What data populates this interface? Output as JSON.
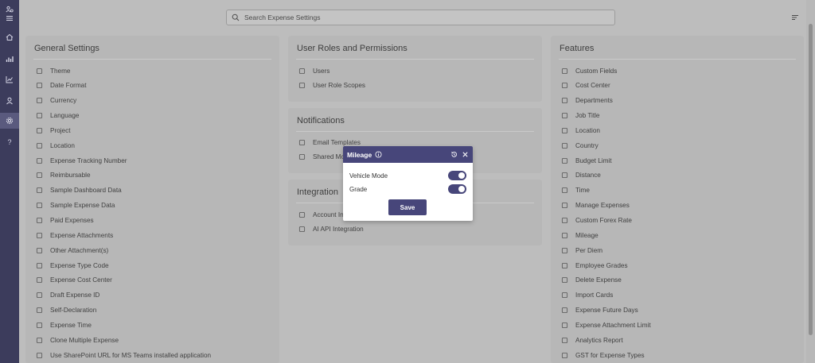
{
  "search": {
    "placeholder": "Search Expense Settings"
  },
  "rail": {
    "icons": [
      "users-cog-icon",
      "menu-icon",
      "home-icon",
      "bar-chart-icon",
      "line-chart-icon",
      "user-icon",
      "gear-icon",
      "help-icon"
    ]
  },
  "general": {
    "title": "General Settings",
    "items": [
      "Theme",
      "Date Format",
      "Currency",
      "Language",
      "Project",
      "Location",
      "Expense Tracking Number",
      "Reimbursable",
      "Sample Dashboard Data",
      "Sample Expense Data",
      "Paid Expenses",
      "Expense Attachments",
      "Other Attachment(s)",
      "Expense Type Code",
      "Expense Cost Center",
      "Draft Expense ID",
      "Self-Declaration",
      "Expense Time",
      "Clone Multiple Expense",
      "Use SharePoint URL for MS Teams installed application"
    ]
  },
  "roles": {
    "title": "User Roles and Permissions",
    "items": [
      "Users",
      "User Role Scopes"
    ]
  },
  "notifications": {
    "title": "Notifications",
    "items": [
      "Email Templates",
      "Shared Mo"
    ]
  },
  "integration": {
    "title": "Integration",
    "items": [
      "Account In",
      "AI API Integration"
    ]
  },
  "features": {
    "title": "Features",
    "items": [
      "Custom Fields",
      "Cost Center",
      "Departments",
      "Job Title",
      "Location",
      "Country",
      "Budget Limit",
      "Distance",
      "Time",
      "Manage Expenses",
      "Custom Forex Rate",
      "Mileage",
      "Per Diem",
      "Employee Grades",
      "Delete Expense",
      "Import Cards",
      "Expense Future Days",
      "Expense Attachment Limit",
      "Analytics Report",
      "GST for Expense Types"
    ]
  },
  "modal": {
    "title": "Mileage",
    "toggles": [
      {
        "label": "Vehicle Mode",
        "on": true
      },
      {
        "label": "Grade",
        "on": true
      }
    ],
    "save_label": "Save"
  },
  "colors": {
    "accent": "#47467a",
    "rail": "#3c3c5c",
    "overlay": "#bdbdbd"
  }
}
